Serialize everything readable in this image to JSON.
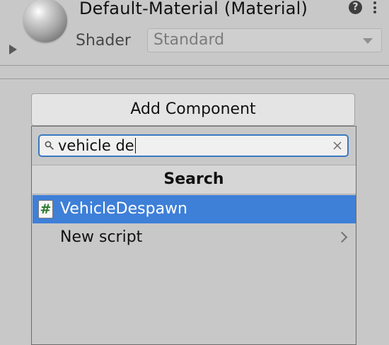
{
  "material": {
    "title": "Default-Material (Material)",
    "help_symbol": "?",
    "shader_label": "Shader",
    "shader_value": "Standard"
  },
  "add_component": {
    "label": "Add Component"
  },
  "search": {
    "query": "vehicle de",
    "header": "Search"
  },
  "results": [
    {
      "icon": "script-icon",
      "icon_glyph": "#",
      "label": "VehicleDespawn",
      "selected": true
    },
    {
      "label": "New script",
      "has_submenu": true
    }
  ],
  "colors": {
    "selection": "#3e7fd8",
    "focus_border": "#3a79bf",
    "script_hash": "#2f7a2f"
  }
}
